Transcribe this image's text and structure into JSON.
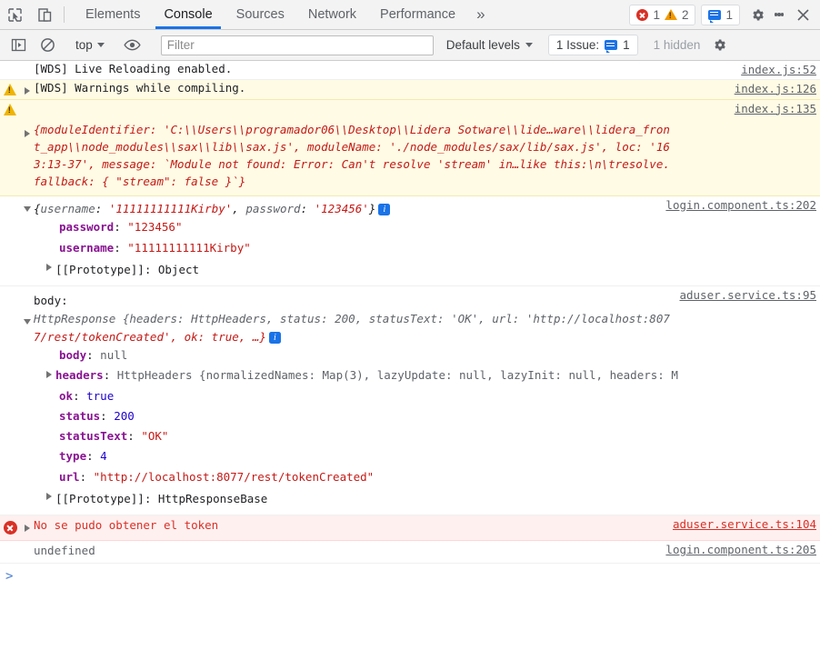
{
  "tabbar": {
    "inspect_icon": "inspect-element-icon",
    "device_icon": "device-toolbar-icon",
    "tabs": [
      {
        "label": "Elements",
        "active": false
      },
      {
        "label": "Console",
        "active": true
      },
      {
        "label": "Sources",
        "active": false
      },
      {
        "label": "Network",
        "active": false
      },
      {
        "label": "Performance",
        "active": false
      }
    ],
    "more_tabs": "»",
    "error_count": "1",
    "warning_count": "2",
    "message_count": "1",
    "settings_icon": "gear-icon",
    "more_icon": "kebab-menu-icon",
    "close_icon": "close-icon"
  },
  "filterbar": {
    "sidebar_icon": "console-sidebar-icon",
    "clear_icon": "clear-console-icon",
    "context": "top",
    "eye_icon": "live-expression-icon",
    "filter_placeholder": "Filter",
    "filter_value": "",
    "levels": "Default levels",
    "issues_label": "1 Issue:",
    "issues_count": "1",
    "hidden_label": "1 hidden",
    "settings_icon": "console-settings-gear-icon"
  },
  "console": {
    "rows": [
      {
        "kind": "plain",
        "text": "[WDS] Live Reloading enabled.",
        "source": "index.js:52"
      },
      {
        "kind": "warn",
        "text": "[WDS] Warnings while compiling.",
        "source": "index.js:126"
      },
      {
        "kind": "warn",
        "source": "index.js:135",
        "detail_lines": [
          "{moduleIdentifier: 'C:\\\\Users\\\\programador06\\\\Desktop\\\\Lidera Sotware\\\\lide…ware\\\\lidera_fron",
          "t_app\\\\node_modules\\\\sax\\\\lib\\\\sax.js', moduleName: './node_modules/sax/lib/sax.js', loc: '16",
          "3:13-37', message: `Module not found: Error: Can't resolve 'stream' in…like this:\\n\\tresolve.",
          "fallback: { \"stream\": false }`}"
        ]
      }
    ],
    "login_object": {
      "source": "login.component.ts:202",
      "summary_prefix": "{",
      "key1": "username",
      "val1": "'11111111111Kirby'",
      "sep": ", ",
      "key2": "password",
      "val2": "'123456'",
      "summary_suffix": "}",
      "props": [
        {
          "key": "password",
          "value": "\"123456\""
        },
        {
          "key": "username",
          "value": "\"11111111111Kirby\""
        }
      ],
      "prototype": "[[Prototype]]: Object"
    },
    "http_response": {
      "body_label": "body:",
      "source": "aduser.service.ts:95",
      "summary_line1": "HttpResponse {headers: HttpHeaders, status: 200, statusText: 'OK', url: 'http://localhost:807",
      "summary_line2": "7/rest/tokenCreated', ok: true, …}",
      "props": [
        {
          "key": "body",
          "value": "null",
          "expandable": false
        },
        {
          "key": "headers",
          "value": "HttpHeaders {normalizedNames: Map(3), lazyUpdate: null, lazyInit: null, headers: M",
          "expandable": true
        },
        {
          "key": "ok",
          "value": "true",
          "expandable": false
        },
        {
          "key": "status",
          "value": "200",
          "expandable": false
        },
        {
          "key": "statusText",
          "value": "\"OK\"",
          "expandable": false
        },
        {
          "key": "type",
          "value": "4",
          "expandable": false
        },
        {
          "key": "url",
          "value": "\"http://localhost:8077/rest/tokenCreated\"",
          "expandable": false
        }
      ],
      "prototype": "[[Prototype]]: HttpResponseBase"
    },
    "error_row": {
      "text": "No se pudo obtener el token",
      "source": "aduser.service.ts:104"
    },
    "undefined_row": {
      "text": "undefined",
      "source": "login.component.ts:205"
    },
    "prompt": ">"
  },
  "colors": {
    "accent": "#1a73e8",
    "error": "#d93025",
    "warning": "#f29900",
    "string": "#c41a16",
    "number": "#1c00cf",
    "key": "#881391",
    "warn_bg": "#fffbe5",
    "error_bg": "#fff0f0"
  }
}
